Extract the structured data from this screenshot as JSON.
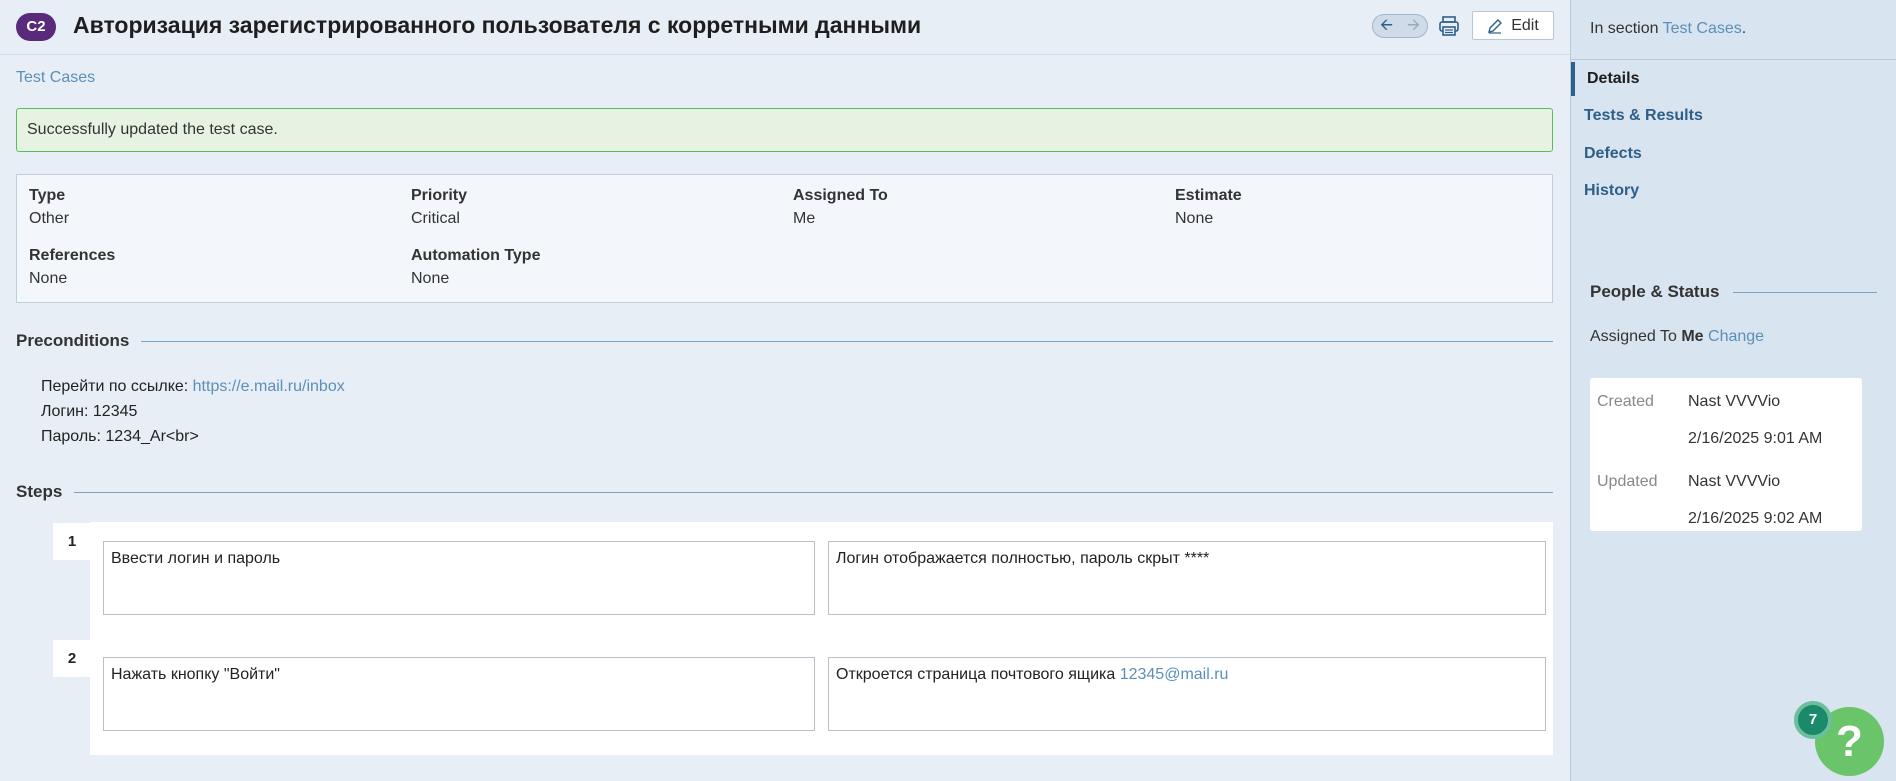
{
  "header": {
    "case_id": "C2",
    "title": "Авторизация зарегистрированного пользователя с корретными данными",
    "edit_label": "Edit"
  },
  "breadcrumb": "Test Cases",
  "message": "Successfully updated the test case.",
  "fields": {
    "type": {
      "label": "Type",
      "value": "Other"
    },
    "priority": {
      "label": "Priority",
      "value": "Critical"
    },
    "assigned_to": {
      "label": "Assigned To",
      "value": "Me"
    },
    "estimate": {
      "label": "Estimate",
      "value": "None"
    },
    "references": {
      "label": "References",
      "value": "None"
    },
    "automation_type": {
      "label": "Automation Type",
      "value": "None"
    }
  },
  "preconditions": {
    "heading": "Preconditions",
    "line1_prefix": "Перейти по ссылке: ",
    "line1_link": "https://e.mail.ru/inbox",
    "line2": "Логин: 12345",
    "line3": "Пароль: 1234_Ar<br>"
  },
  "steps": {
    "heading": "Steps",
    "items": [
      {
        "num": "1",
        "action": "Ввести логин и пароль",
        "expected": "Логин отображается полностью, пароль скрыт ****",
        "expected_link": ""
      },
      {
        "num": "2",
        "action": "Нажать кнопку \"Войти\"",
        "expected": "Откроется страница почтового ящика ",
        "expected_link": "12345@mail.ru"
      }
    ]
  },
  "sidebar": {
    "in_section_prefix": "In section ",
    "in_section_link": "Test Cases",
    "in_section_suffix": ".",
    "tabs": [
      "Details",
      "Tests & Results",
      "Defects",
      "History"
    ],
    "people_heading": "People & Status",
    "assigned_prefix": "Assigned To ",
    "assigned_value": "Me",
    "change_label": "Change",
    "created_label": "Created",
    "created_by": "Nast VVVVio",
    "created_at": "2/16/2025 9:01 AM",
    "updated_label": "Updated",
    "updated_by": "Nast VVVVio",
    "updated_at": "2/16/2025 9:02 AM"
  },
  "help": {
    "count": "7",
    "symbol": "?"
  },
  "colors": {
    "badge": "#5a2a7a",
    "link": "#5b8fb9",
    "success_border": "#5dbb5d",
    "help": "#6ac46a"
  }
}
